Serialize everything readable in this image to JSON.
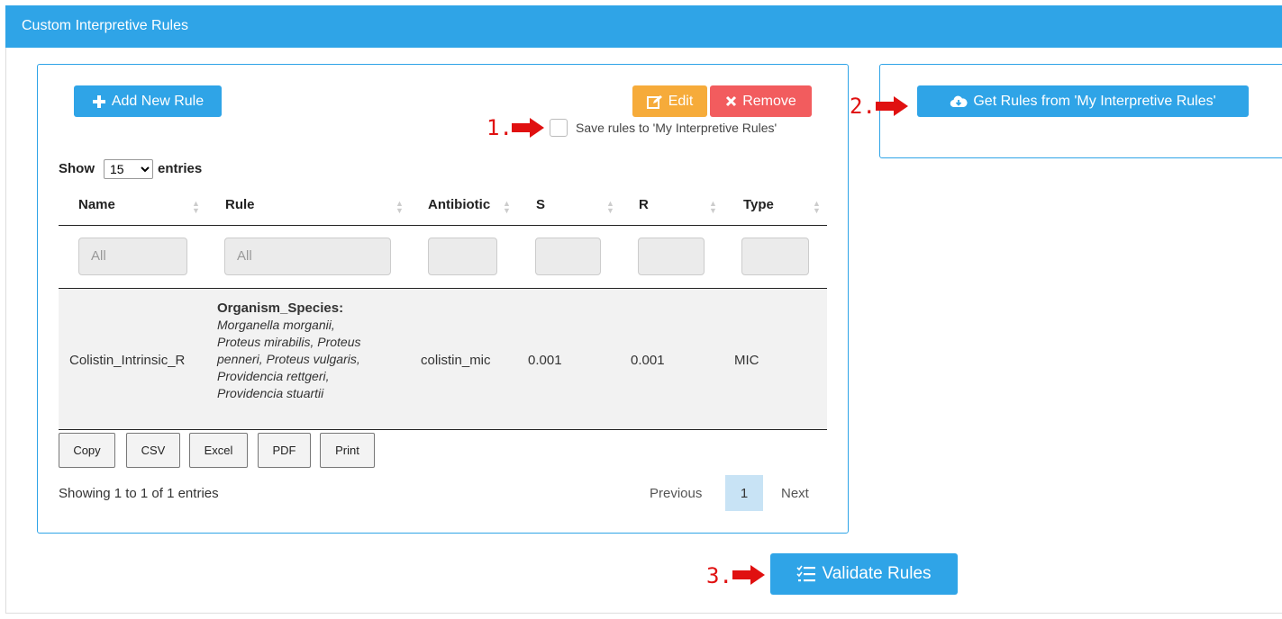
{
  "panel": {
    "title": "Custom Interpretive Rules"
  },
  "toolbar": {
    "add_label": "Add New Rule",
    "edit_label": "Edit",
    "remove_label": "Remove",
    "save_checkbox_label": "Save rules to 'My Interpretive Rules'",
    "save_checked": false
  },
  "right_panel": {
    "get_rules_label": "Get Rules from 'My Interpretive Rules'"
  },
  "annotations": {
    "n1": "1.",
    "n2": "2.",
    "n3": "3."
  },
  "length": {
    "show": "Show",
    "value": "15",
    "options": [
      "15"
    ],
    "entries": "entries"
  },
  "table": {
    "columns": [
      "Name",
      "Rule",
      "Antibiotic",
      "S",
      "R",
      "Type"
    ],
    "filters": {
      "name": "All",
      "rule": "All"
    },
    "rows": [
      {
        "name": "Colistin_Intrinsic_R",
        "rule_key": "Organism_Species:",
        "rule_lines": [
          "Morganella morganii,",
          "Proteus mirabilis, Proteus",
          "penneri, Proteus vulgaris,",
          "Providencia rettgeri,",
          "Providencia stuartii"
        ],
        "antibiotic": "colistin_mic",
        "s": "0.001",
        "r": "0.001",
        "type": "MIC"
      }
    ]
  },
  "export_buttons": [
    "Copy",
    "CSV",
    "Excel",
    "PDF",
    "Print"
  ],
  "info": "Showing 1 to 1 of 1 entries",
  "pagination": {
    "previous": "Previous",
    "current": "1",
    "next": "Next"
  },
  "validate_label": "Validate Rules",
  "colors": {
    "primary": "#2fa4e7",
    "warning": "#f6ab3a",
    "danger": "#f25c5e",
    "annotation": "#e01010"
  },
  "icons": {
    "add": "plus-icon",
    "edit": "edit-icon",
    "remove": "times-icon",
    "cloud": "cloud-download-icon",
    "validate": "tasks-icon",
    "arrow": "arrow-right-icon"
  }
}
